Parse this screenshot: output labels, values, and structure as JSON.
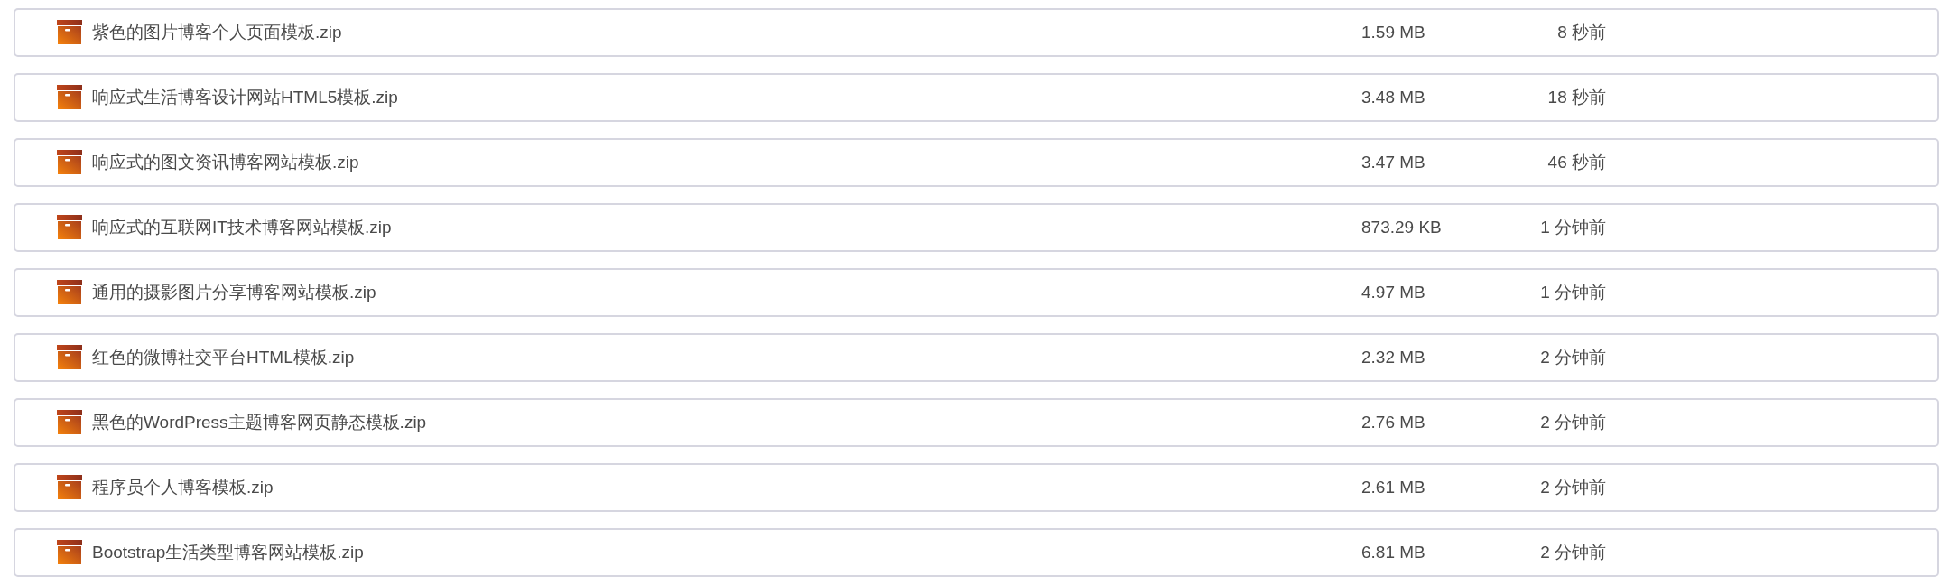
{
  "files": [
    {
      "name": "紫色的图片博客个人页面模板.zip",
      "size": "1.59 MB",
      "time": "8 秒前"
    },
    {
      "name": "响应式生活博客设计网站HTML5模板.zip",
      "size": "3.48 MB",
      "time": "18 秒前"
    },
    {
      "name": "响应式的图文资讯博客网站模板.zip",
      "size": "3.47 MB",
      "time": "46 秒前"
    },
    {
      "name": "响应式的互联网IT技术博客网站模板.zip",
      "size": "873.29 KB",
      "time": "1 分钟前"
    },
    {
      "name": "通用的摄影图片分享博客网站模板.zip",
      "size": "4.97 MB",
      "time": "1 分钟前"
    },
    {
      "name": "红色的微博社交平台HTML模板.zip",
      "size": "2.32 MB",
      "time": "2 分钟前"
    },
    {
      "name": "黑色的WordPress主题博客网页静态模板.zip",
      "size": "2.76 MB",
      "time": "2 分钟前"
    },
    {
      "name": "程序员个人博客模板.zip",
      "size": "2.61 MB",
      "time": "2 分钟前"
    },
    {
      "name": "Bootstrap生活类型博客网站模板.zip",
      "size": "6.81 MB",
      "time": "2 分钟前"
    }
  ]
}
